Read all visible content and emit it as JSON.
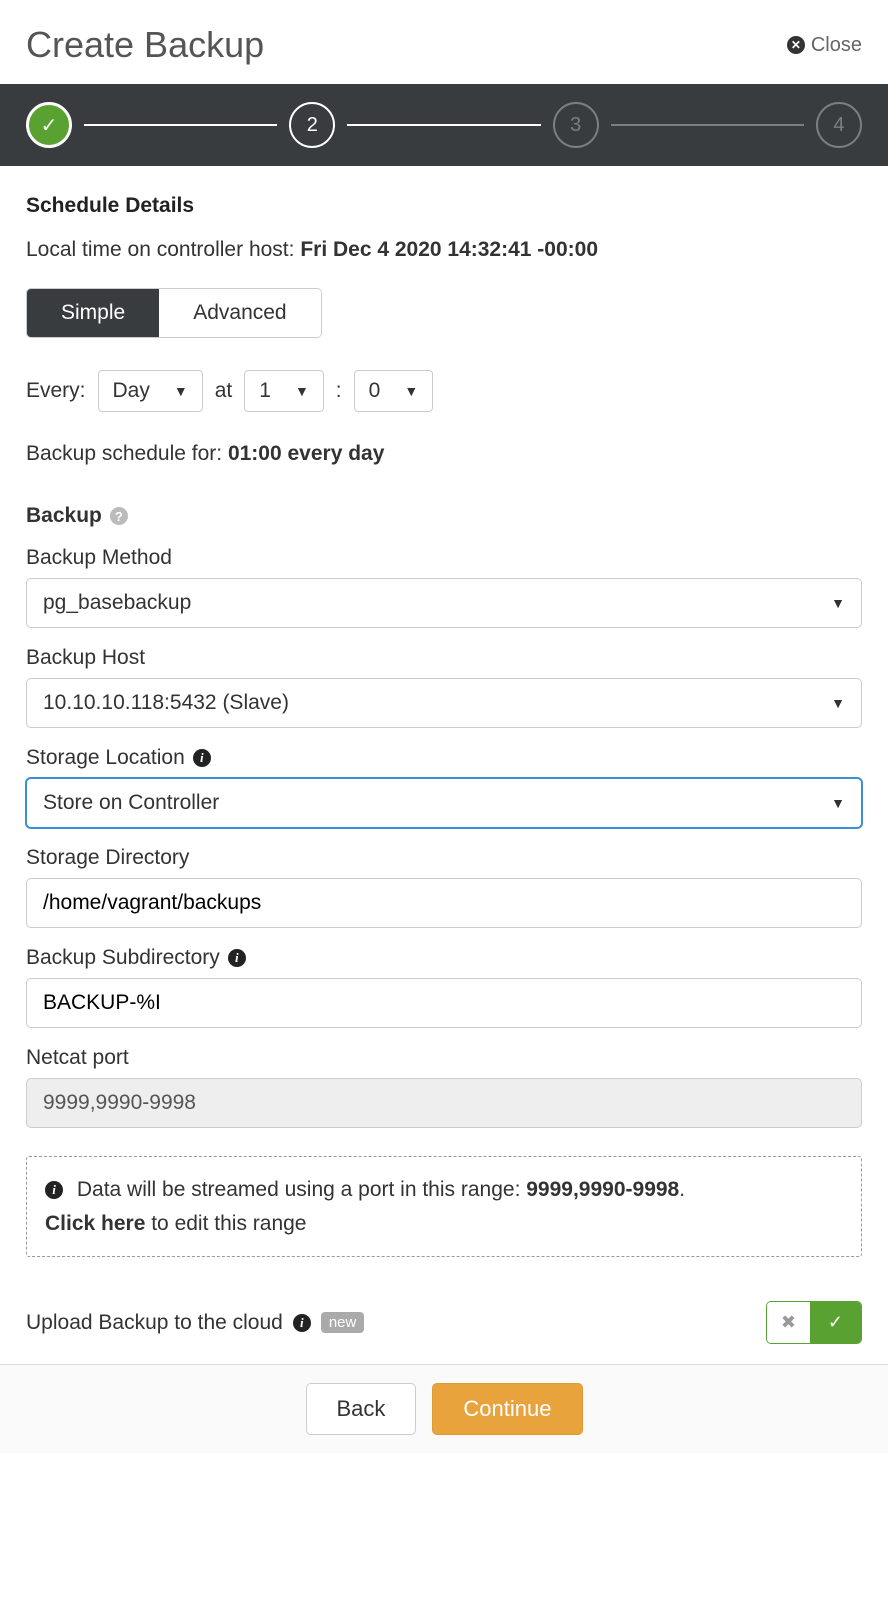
{
  "header": {
    "title": "Create Backup",
    "close_label": "Close"
  },
  "stepper": {
    "step1": "done",
    "step2": "2",
    "step3": "3",
    "step4": "4"
  },
  "schedule": {
    "section_title": "Schedule Details",
    "localtime_label": "Local time on controller host: ",
    "localtime_value": "Fri Dec 4 2020 14:32:41 -00:00",
    "tab_simple": "Simple",
    "tab_advanced": "Advanced",
    "every_label": "Every:",
    "every_value": "Day",
    "at_label": "at",
    "hour_value": "1",
    "colon": ":",
    "minute_value": "0",
    "summary_label": "Backup schedule for: ",
    "summary_value": "01:00 every day"
  },
  "backup": {
    "section_title": "Backup",
    "method_label": "Backup Method",
    "method_value": "pg_basebackup",
    "host_label": "Backup Host",
    "host_value": "10.10.10.118:5432 (Slave)",
    "storage_loc_label": "Storage Location",
    "storage_loc_value": "Store on Controller",
    "storage_dir_label": "Storage Directory",
    "storage_dir_value": "/home/vagrant/backups",
    "subdir_label": "Backup Subdirectory",
    "subdir_value": "BACKUP-%I",
    "netcat_label": "Netcat port",
    "netcat_value": "9999,9990-9998",
    "info_text1": "Data will be streamed using a port in this range: ",
    "info_text1_bold": "9999,9990-9998",
    "info_text1_end": ".",
    "info_text2_bold": "Click here",
    "info_text2_end": " to edit this range"
  },
  "upload": {
    "label": "Upload Backup to the cloud",
    "badge": "new"
  },
  "footer": {
    "back": "Back",
    "continue": "Continue"
  }
}
